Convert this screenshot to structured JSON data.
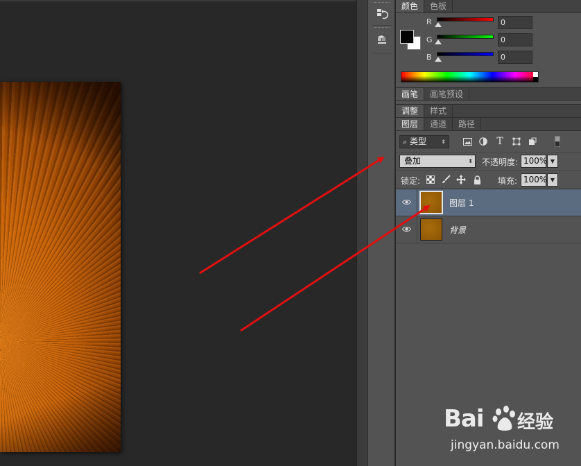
{
  "color_panel": {
    "tabs": [
      "颜色",
      "色板"
    ],
    "channels": [
      {
        "label": "R",
        "value": "0",
        "color": "#ff0000"
      },
      {
        "label": "G",
        "value": "0",
        "color": "#00ff00"
      },
      {
        "label": "B",
        "value": "0",
        "color": "#0000ff"
      }
    ],
    "foreground": "#000000",
    "background": "#ffffff"
  },
  "brush_panel": {
    "tabs": [
      "画笔",
      "画笔预设"
    ]
  },
  "adjust_panel": {
    "tabs": [
      "调整",
      "样式"
    ]
  },
  "layers_panel": {
    "tabs": [
      "图层",
      "通道",
      "路径"
    ],
    "filter_kind": "类型",
    "filter_icons": [
      "image-filter-icon",
      "adjustment-filter-icon",
      "type-filter-icon",
      "shape-filter-icon",
      "smart-object-filter-icon"
    ],
    "blend_mode": "叠加",
    "opacity_label": "不透明度:",
    "opacity_value": "100%",
    "lock_label": "锁定:",
    "fill_label": "填充:",
    "fill_value": "100%",
    "layers": [
      {
        "name": "图层 1",
        "selected": true,
        "visible": true
      },
      {
        "name": "背景",
        "selected": false,
        "visible": true,
        "italic": true
      }
    ]
  },
  "watermark": {
    "brand_left": "Bai",
    "brand_right": "经验",
    "url": "jingyan.baidu.com"
  },
  "colors": {
    "accent_selected": "#5b6b80",
    "arrow": "#e01010"
  }
}
